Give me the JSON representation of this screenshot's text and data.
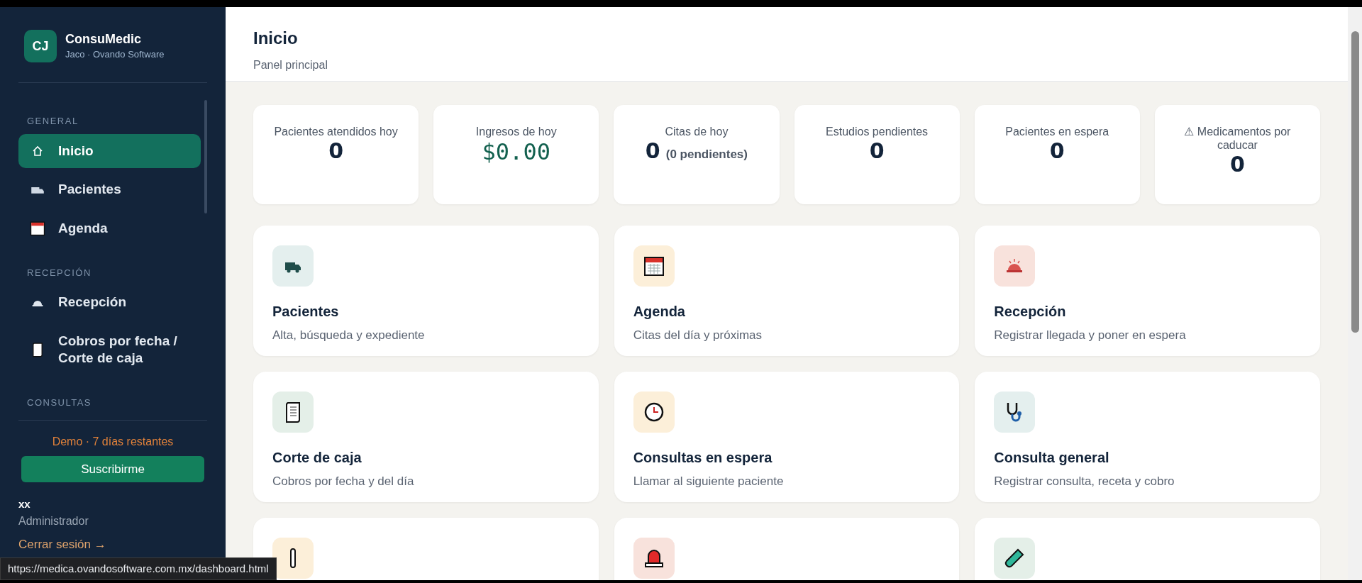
{
  "sidebar": {
    "logo": {
      "initials": "CJ",
      "name": "ConsuMedic",
      "subtitle": "Jaco · Ovando Software"
    },
    "sections": [
      {
        "title": "GENERAL",
        "items": [
          {
            "label": "Inicio",
            "selected": true
          },
          {
            "label": "Pacientes",
            "selected": false
          },
          {
            "label": "Agenda",
            "selected": false
          }
        ]
      },
      {
        "title": "RECEPCIÓN",
        "items": [
          {
            "label": "Recepción",
            "selected": false
          },
          {
            "label": "Cobros por fecha / Corte de caja",
            "selected": false
          }
        ]
      },
      {
        "title": "CONSULTAS"
      }
    ],
    "trial": "Demo · 7 días restantes",
    "subscribe_button": "Suscribirme",
    "user": {
      "name": "xx",
      "role": "Administrador",
      "logout": "Cerrar sesión →"
    }
  },
  "header": {
    "title": "Inicio",
    "subtitle": "Panel principal"
  },
  "stats": [
    {
      "label": "Pacientes atendidos hoy",
      "value": "0",
      "kind": "count"
    },
    {
      "label": "Ingresos de hoy",
      "value": "$0.00",
      "kind": "currency"
    },
    {
      "label": "Citas de hoy",
      "value": "0",
      "note": "(0 pendientes)",
      "kind": "count"
    },
    {
      "label": "Estudios pendientes",
      "value": "0",
      "kind": "count"
    },
    {
      "label": "Pacientes en espera",
      "value": "0",
      "kind": "count"
    },
    {
      "label": "⚠ Medicamentos por caducar",
      "value": "0",
      "kind": "count"
    }
  ],
  "cards": [
    {
      "title": "Pacientes",
      "description": "Alta, búsqueda y expediente",
      "color": "#e4efee"
    },
    {
      "title": "Agenda",
      "description": "Citas del día y próximas",
      "color": "#fcefd9"
    },
    {
      "title": "Recepción",
      "description": "Registrar llegada y poner en espera",
      "color": "#f8e2dc"
    },
    {
      "title": "Corte de caja",
      "description": "Cobros por fecha y del día",
      "color": "#e4efe8"
    },
    {
      "title": "Consultas en espera",
      "description": "Llamar al siguiente paciente",
      "color": "#fcefd9"
    },
    {
      "title": "Consulta general",
      "description": "Registrar consulta, receta y cobro",
      "color": "#e4efee"
    },
    {
      "color": "#fcefd9"
    },
    {
      "color": "#f8e2dc"
    },
    {
      "color": "#e4efe8"
    }
  ],
  "status_bar": "https://medica.ovandosoftware.com.mx/dashboard.html"
}
